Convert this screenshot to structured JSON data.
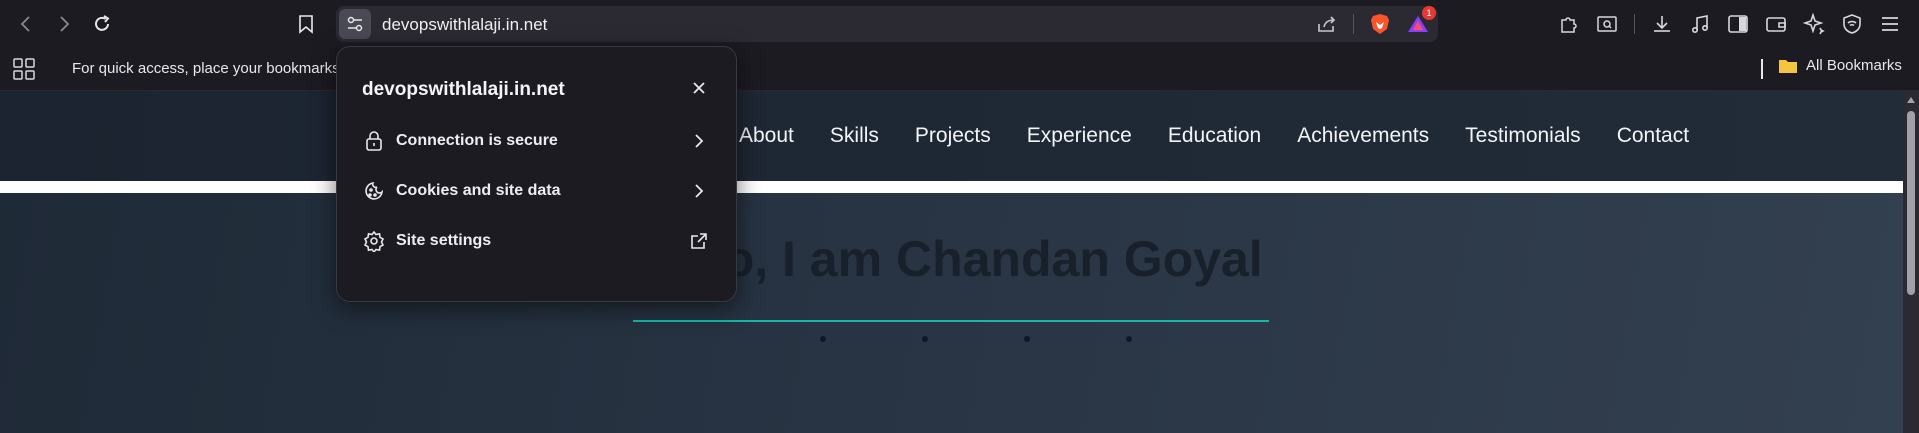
{
  "browser": {
    "url": "devopswithlalaji.in.net",
    "notification_count": "1",
    "bookmarks_hint": "For quick access, place your bookmarks",
    "all_bookmarks_label": "All Bookmarks"
  },
  "site_popup": {
    "domain": "devopswithlalaji.in.net",
    "items": [
      {
        "label": "Connection is secure",
        "icon": "lock-icon",
        "trail": "chevron-right-icon"
      },
      {
        "label": "Cookies and site data",
        "icon": "cookie-icon",
        "trail": "chevron-right-icon"
      },
      {
        "label": "Site settings",
        "icon": "gear-icon",
        "trail": "external-link-icon"
      }
    ]
  },
  "website": {
    "nav": [
      "About",
      "Skills",
      "Projects",
      "Experience",
      "Education",
      "Achievements",
      "Testimonials",
      "Contact"
    ],
    "hero_title": "Hello, I am Chandan Goyal"
  },
  "colors": {
    "accent_line": "#14b8a6",
    "browser_bg": "#1c1b22",
    "omnibox_bg": "#2b2a33"
  }
}
